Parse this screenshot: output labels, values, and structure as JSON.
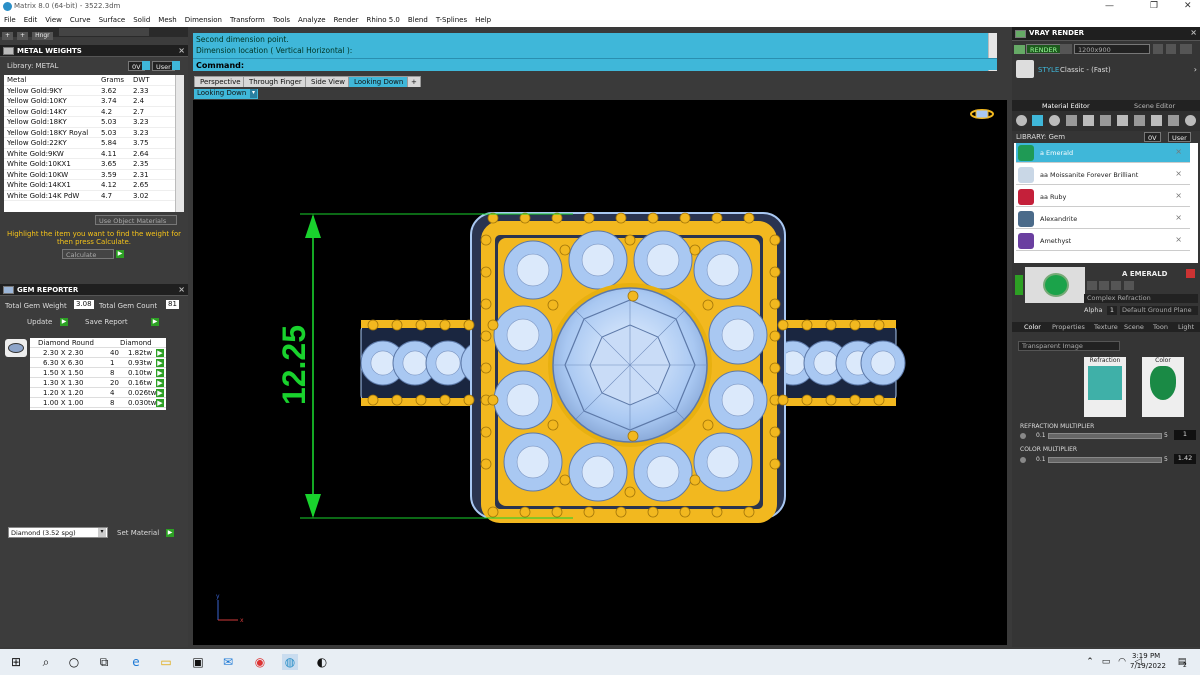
{
  "window": {
    "title": "Matrix 8.0 (64-bit) - 3522.3dm",
    "controls": [
      "—",
      "❐",
      "✕"
    ]
  },
  "menu": [
    "File",
    "Edit",
    "View",
    "Curve",
    "Surface",
    "Solid",
    "Mesh",
    "Dimension",
    "Transform",
    "Tools",
    "Analyze",
    "Render",
    "Rhino 5.0",
    "Blend",
    "T-Splines",
    "Help"
  ],
  "toolbar": {
    "small_btns": [
      "+",
      "+",
      "Hngr"
    ]
  },
  "metal_weights": {
    "title": "METAL WEIGHTS",
    "library_label": "Library: METAL",
    "lib_btn1": "0V",
    "lib_btn2": "User",
    "headers": [
      "Metal",
      "Grams",
      "DWT"
    ],
    "rows": [
      [
        "Yellow Gold:9KY",
        "3.62",
        "2.33"
      ],
      [
        "Yellow Gold:10KY",
        "3.74",
        "2.4"
      ],
      [
        "Yellow Gold:14KY",
        "4.2",
        "2.7"
      ],
      [
        "Yellow Gold:18KY",
        "5.03",
        "3.23"
      ],
      [
        "Yellow Gold:18KY Royal",
        "5.03",
        "3.23"
      ],
      [
        "Yellow Gold:22KY",
        "5.84",
        "3.75"
      ],
      [
        "White Gold:9KW",
        "4.11",
        "2.64"
      ],
      [
        "White Gold:10KX1",
        "3.65",
        "2.35"
      ],
      [
        "White Gold:10KW",
        "3.59",
        "2.31"
      ],
      [
        "White Gold:14KX1",
        "4.12",
        "2.65"
      ],
      [
        "White Gold:14K PdW",
        "4.7",
        "3.02"
      ]
    ],
    "use_object_materials": "Use Object Materials",
    "hint": "Highlight the item you want to find the weight for then press Calculate.",
    "calculate": "Calculate"
  },
  "gem_reporter": {
    "title": "GEM REPORTER",
    "total_weight_label": "Total Gem Weight",
    "total_weight_value": "3.08",
    "total_count_label": "Total Gem Count",
    "total_count_value": "81",
    "update": "Update",
    "save_report": "Save Report",
    "headers": [
      "Diamond Round",
      "Diamond"
    ],
    "rows": [
      [
        "2.30 X 2.30",
        "40",
        "1.82tw"
      ],
      [
        "6.30 X 6.30",
        "1",
        "0.93tw"
      ],
      [
        "1.50 X 1.50",
        "8",
        "0.10tw"
      ],
      [
        "1.30 X 1.30",
        "20",
        "0.16tw"
      ],
      [
        "1.20 X 1.20",
        "4",
        "0.026tw"
      ],
      [
        "1.00 X 1.00",
        "8",
        "0.030tw"
      ]
    ],
    "material_select": "Diamond    (3.52 spg)",
    "set_material": "Set Material"
  },
  "command": {
    "line1": "Second dimension point.",
    "line2": "Dimension location ( Vertical  Horizontal ):",
    "label": "Command:"
  },
  "view_tabs": [
    "Perspective",
    "Through Finger",
    "Side View",
    "Looking Down"
  ],
  "active_view": "Looking Down",
  "view_add": "+",
  "viewport": {
    "dimension": "12.25",
    "axis_y": "y",
    "axis_x": "x"
  },
  "vray": {
    "title": "VRAY RENDER",
    "render_btn": "RENDER",
    "resolution": "1200x900",
    "style_label": "STYLE",
    "style_value": "Classic - (Fast)",
    "tabs": [
      "Material Editor",
      "Scene Editor"
    ],
    "library_label": "LIBRARY: Gem",
    "lib_btn1": "0V",
    "lib_btn2": "User",
    "materials": [
      {
        "name": "a Emerald",
        "color": "#1f9a55",
        "selected": true
      },
      {
        "name": "aa Moissanite Forever Brilliant",
        "color": "#c9d7e6",
        "selected": false
      },
      {
        "name": "aa Ruby",
        "color": "#c4203a",
        "selected": false
      },
      {
        "name": "Alexandrite",
        "color": "#4b6b8a",
        "selected": false
      },
      {
        "name": "Amethyst",
        "color": "#6a3fa0",
        "selected": false
      }
    ],
    "preview_name": "A EMERALD",
    "shader": "Complex Refraction",
    "alpha_label": "Alpha",
    "alpha_value": "1",
    "ground": "Default Ground Plane",
    "subtabs": [
      "Color",
      "Properties",
      "Texture",
      "Scene",
      "Toon",
      "Light"
    ],
    "map_type": "Transparent Image",
    "refraction_label": "Refraction",
    "color_label": "Color",
    "refraction_multiplier_label": "REFRACTION MULTIPLIER",
    "refraction_min": "0.1",
    "refraction_max": "5",
    "refraction_value": "1",
    "color_multiplier_label": "COLOR MULTIPLIER",
    "color_min": "0.1",
    "color_max": "5",
    "color_value": "1.42"
  },
  "taskbar": {
    "time": "3:19 PM",
    "date": "7/19/2022",
    "notif": "2"
  },
  "colors": {
    "accent": "#3fb7d9",
    "gold": "#f2b81f",
    "diamond": "#a9c8f2",
    "dim_green": "#19d22d"
  }
}
